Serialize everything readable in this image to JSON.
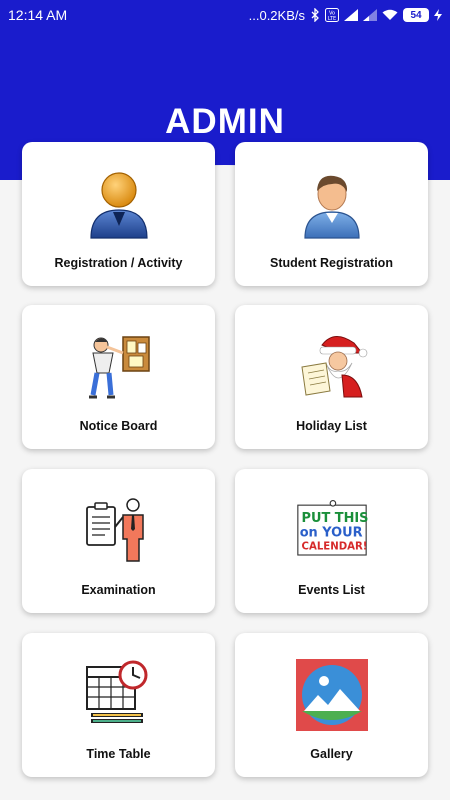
{
  "status_bar": {
    "time": "12:14 AM",
    "network_speed": "...0.2KB/s",
    "volte": "Vo LTE",
    "battery": "54"
  },
  "header": {
    "title": "ADMIN"
  },
  "menu": [
    {
      "label": "Registration / Activity",
      "icon": "admin-user-icon"
    },
    {
      "label": "Student Registration",
      "icon": "student-user-icon"
    },
    {
      "label": "Notice Board",
      "icon": "notice-board-icon"
    },
    {
      "label": "Holiday List",
      "icon": "santa-holiday-icon"
    },
    {
      "label": "Examination",
      "icon": "examination-icon"
    },
    {
      "label": "Events List",
      "icon": "calendar-events-icon"
    },
    {
      "label": "Time Table",
      "icon": "time-table-icon"
    },
    {
      "label": "Gallery",
      "icon": "gallery-icon"
    }
  ],
  "icon_text": {
    "events_line1": "PUT THIS",
    "events_line2": "on YOUR",
    "events_line3": "CALENDAR!"
  },
  "colors": {
    "primary": "#1a1ccc",
    "background": "#f5f5f5",
    "card": "#ffffff"
  }
}
